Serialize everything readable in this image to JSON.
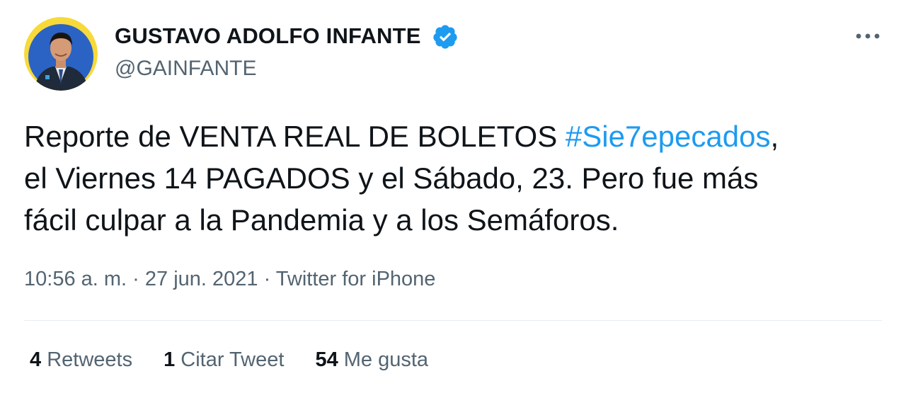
{
  "author": {
    "display_name": "GUSTAVO ADOLFO INFANTE",
    "handle": "@GAINFANTE",
    "verified": true
  },
  "tweet": {
    "text_part1": "Reporte de VENTA REAL DE BOLETOS ",
    "hashtag": "#Sie7epecados",
    "text_part1_end": ",",
    "line2": "el Viernes 14 PAGADOS y el Sábado, 23. Pero fue más",
    "line3": "fácil culpar a la Pandemia y a los Semáforos."
  },
  "meta": {
    "time": "10:56 a. m.",
    "separator": " · ",
    "date": "27 jun. 2021",
    "source": "Twitter for iPhone"
  },
  "stats": {
    "retweets_count": "4",
    "retweets_label": "Retweets",
    "quotes_count": "1",
    "quotes_label": "Citar Tweet",
    "likes_count": "54",
    "likes_label": "Me gusta"
  },
  "icons": {
    "verified": "verified-badge-icon",
    "more": "more-options-icon"
  },
  "colors": {
    "hashtag": "#1d9bf0",
    "verified": "#1d9bf0",
    "secondary_text": "#536471",
    "primary_text": "#0f1419",
    "avatar_ring": "#f7d93a",
    "avatar_bg": "#2b63c4"
  }
}
